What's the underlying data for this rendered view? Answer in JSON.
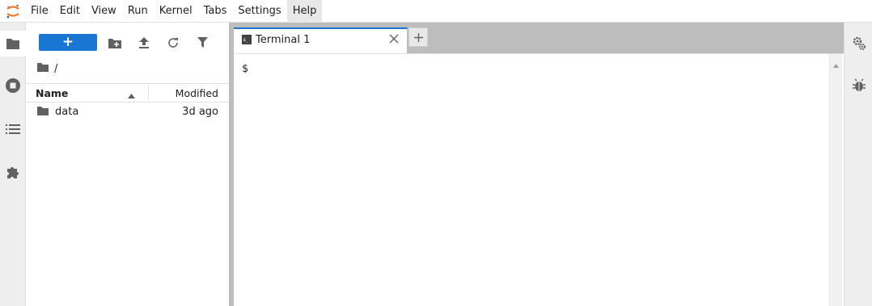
{
  "menubar": {
    "logo_icon": "jupyter-logo",
    "items": [
      {
        "label": "File"
      },
      {
        "label": "Edit"
      },
      {
        "label": "View"
      },
      {
        "label": "Run"
      },
      {
        "label": "Kernel"
      },
      {
        "label": "Tabs"
      },
      {
        "label": "Settings"
      },
      {
        "label": "Help",
        "active": true
      }
    ]
  },
  "left_sidebar": {
    "icons": [
      "folder-icon",
      "running-icon",
      "toc-icon",
      "extension-icon"
    ],
    "selected": "folder-icon"
  },
  "filebrowser": {
    "new_button_label": "+",
    "toolbar_icons": [
      "new-folder-icon",
      "upload-icon",
      "refresh-icon",
      "filter-icon"
    ],
    "breadcrumb": "/",
    "columns": {
      "name": "Name",
      "modified": "Modified"
    },
    "sort": "ascending",
    "rows": [
      {
        "type": "folder",
        "name": "data",
        "modified": "3d ago"
      }
    ]
  },
  "main": {
    "tabs": [
      {
        "label": "Terminal 1",
        "icon": "terminal-icon",
        "active": true
      }
    ],
    "add_tab_label": "+",
    "terminal": {
      "prompt": "$"
    }
  },
  "right_sidebar": {
    "icons": [
      "property-inspector-icon",
      "debugger-icon"
    ]
  },
  "colors": {
    "accent": "#1976d2",
    "jupyter_orange": "#f37726"
  }
}
